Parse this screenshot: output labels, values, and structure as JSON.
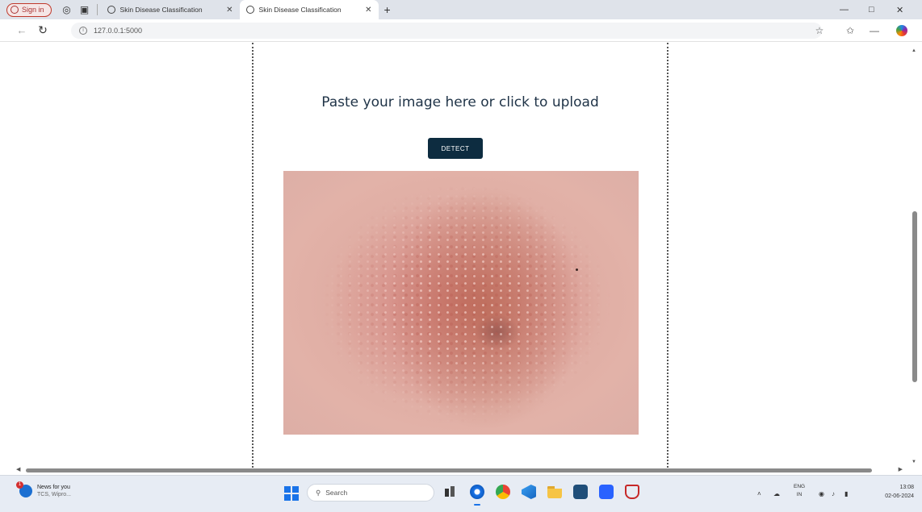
{
  "browser": {
    "signin_label": "Sign in",
    "tabs": [
      {
        "title": "Skin Disease Classification",
        "active": false
      },
      {
        "title": "Skin Disease Classification",
        "active": true
      }
    ],
    "new_tab_symbol": "+",
    "url": "127.0.0.1:5000"
  },
  "page": {
    "upload_prompt": "Paste your image here or click to upload",
    "detect_button": "DETECT"
  },
  "taskbar": {
    "weather_title": "News for you",
    "weather_subtitle": "TCS, Wipro...",
    "notification_count": "1",
    "search_placeholder": "Search",
    "lang_top": "ENG",
    "lang_bottom": "IN",
    "time": "13:08",
    "date": "02-06-2024"
  },
  "colors": {
    "detect_button_bg": "#0d2c40",
    "upload_text": "#1f3347",
    "accent": "#1a73e8"
  }
}
